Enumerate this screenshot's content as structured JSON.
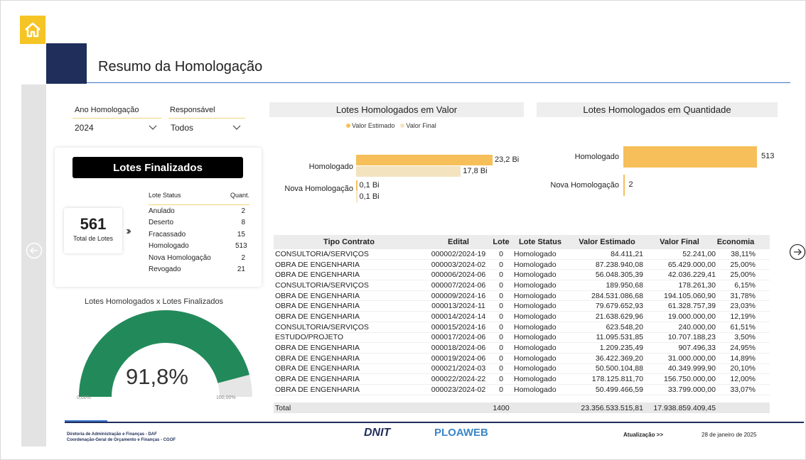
{
  "page": {
    "title": "Resumo da Homologação",
    "colors": {
      "navy": "#1f2e5a",
      "yellow": "#f5c425",
      "bar_estimado": "#f6bf5a",
      "bar_final": "#f3e3bf",
      "gauge_fill": "#228a5a",
      "gauge_bg": "#e6e6e6"
    }
  },
  "filters": {
    "ano": {
      "label": "Ano Homologação",
      "value": "2024"
    },
    "responsavel": {
      "label": "Responsável",
      "value": "Todos"
    }
  },
  "lotes_finalizados": {
    "title": "Lotes Finalizados",
    "total_value": "561",
    "total_label": "Total de Lotes",
    "table": {
      "headers": [
        "Lote Status",
        "Quant."
      ],
      "rows": [
        {
          "status": "Anulado",
          "quant": "2"
        },
        {
          "status": "Deserto",
          "quant": "8"
        },
        {
          "status": "Fracassado",
          "quant": "15"
        },
        {
          "status": "Homologado",
          "quant": "513"
        },
        {
          "status": "Nova Homologação",
          "quant": "2"
        },
        {
          "status": "Revogado",
          "quant": "21"
        }
      ]
    }
  },
  "gauge": {
    "title": "Lotes Homologados x Lotes Finalizados",
    "value_label": "91,8%",
    "value": 0.918,
    "min_label": "0,00%",
    "max_label": "100,00%"
  },
  "chart_data": [
    {
      "type": "bar",
      "title": "Lotes Homologados em Valor",
      "categories": [
        "Homologado",
        "Nova Homologação"
      ],
      "series": [
        {
          "name": "Valor Estimado",
          "values": [
            23.2,
            0.1
          ],
          "labels": [
            "23,2 Bi",
            "0,1 Bi"
          ]
        },
        {
          "name": "Valor Final",
          "values": [
            17.8,
            0.1
          ],
          "labels": [
            "17,8 Bi",
            "0,1 Bi"
          ]
        }
      ]
    },
    {
      "type": "bar",
      "title": "Lotes Homologados em Quantidade",
      "categories": [
        "Homologado",
        "Nova Homologação"
      ],
      "series": [
        {
          "values": [
            513,
            2
          ],
          "labels": [
            "513",
            "2"
          ]
        }
      ]
    }
  ],
  "contracts": {
    "headers": [
      "Tipo Contrato",
      "Edital",
      "Lote",
      "Lote Status",
      "Valor Estimado",
      "Valor Final",
      "Economia"
    ],
    "rows": [
      [
        "CONSULTORIA/SERVIÇOS",
        "000002/2024-19",
        "0",
        "Homologado",
        "84.411,21",
        "52.241,00",
        "38,11%"
      ],
      [
        "OBRA DE ENGENHARIA",
        "000003/2024-02",
        "0",
        "Homologado",
        "87.238.940,08",
        "65.429.000,00",
        "25,00%"
      ],
      [
        "OBRA DE ENGENHARIA",
        "000006/2024-06",
        "0",
        "Homologado",
        "56.048.305,39",
        "42.036.229,41",
        "25,00%"
      ],
      [
        "CONSULTORIA/SERVIÇOS",
        "000007/2024-06",
        "0",
        "Homologado",
        "189.950,68",
        "178.261,30",
        "6,15%"
      ],
      [
        "OBRA DE ENGENHARIA",
        "000009/2024-16",
        "0",
        "Homologado",
        "284.531.086,68",
        "194.105.060,90",
        "31,78%"
      ],
      [
        "OBRA DE ENGENHARIA",
        "000013/2024-11",
        "0",
        "Homologado",
        "79.679.652,93",
        "61.328.757,39",
        "23,03%"
      ],
      [
        "OBRA DE ENGENHARIA",
        "000014/2024-14",
        "0",
        "Homologado",
        "21.638.629,96",
        "19.000.000,00",
        "12,19%"
      ],
      [
        "CONSULTORIA/SERVIÇOS",
        "000015/2024-16",
        "0",
        "Homologado",
        "623.548,20",
        "240.000,00",
        "61,51%"
      ],
      [
        "ESTUDO/PROJETO",
        "000017/2024-06",
        "0",
        "Homologado",
        "11.095.531,85",
        "10.707.188,23",
        "3,50%"
      ],
      [
        "OBRA DE ENGENHARIA",
        "000018/2024-06",
        "0",
        "Homologado",
        "1.209.235,49",
        "907.496,33",
        "24,95%"
      ],
      [
        "OBRA DE ENGENHARIA",
        "000019/2024-06",
        "0",
        "Homologado",
        "36.422.369,20",
        "31.000.000,00",
        "14,89%"
      ],
      [
        "OBRA DE ENGENHARIA",
        "000021/2024-03",
        "0",
        "Homologado",
        "50.500.104,88",
        "40.349.999,90",
        "20,10%"
      ],
      [
        "OBRA DE ENGENHARIA",
        "000022/2024-22",
        "0",
        "Homologado",
        "178.125.811,70",
        "156.750.000,00",
        "12,00%"
      ],
      [
        "OBRA DE ENGENHARIA",
        "000023/2024-02",
        "0",
        "Homologado",
        "50.499.466,59",
        "33.799.000,00",
        "33,07%"
      ]
    ],
    "total": {
      "label": "Total",
      "lote": "1400",
      "estimado": "23.356.533.515,81",
      "final": "17.938.859.409,45"
    }
  },
  "footer": {
    "line1": "Diretoria de Administração e Finanças - DAF",
    "line2": "Coordenação-Geral de Orçamento e Finanças - CGOF",
    "logo1": "DNIT",
    "logo2": "PLOAWEB",
    "update_label": "Atualização >>",
    "update_date": "28 de janeiro de 2025"
  }
}
